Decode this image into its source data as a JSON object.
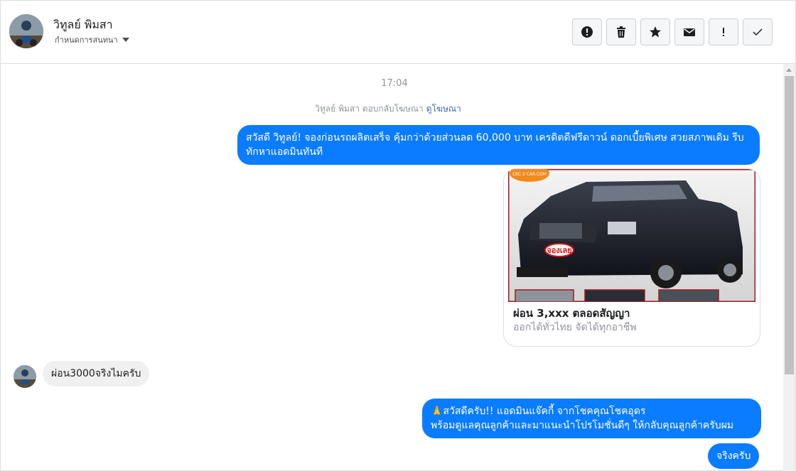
{
  "header": {
    "name": "วิทูลย์ พิมสา",
    "subtitle": "กำหนดการสนทนา",
    "actions": [
      {
        "icon": "alert-circle-icon"
      },
      {
        "icon": "trash-icon"
      },
      {
        "icon": "star-icon"
      },
      {
        "icon": "envelope-icon"
      },
      {
        "icon": "exclamation-icon"
      },
      {
        "icon": "checkmark-icon"
      }
    ]
  },
  "conversation": {
    "timestamp": "17:04",
    "reply_note": "วิทูลย์ พิมสา ตอบกลับโฆษณา",
    "reply_link": "ดูโฆษณา",
    "messages": [
      {
        "direction": "out",
        "text": "สวัสดี วิทูลย์! จองก่อนรถผลิตเสร็จ คุ้มกว่าด้วยส่วนลด 60,000 บาท เครดิตดีฟรีดาวน์ ดอกเบี้ยพิเศษ สวยสภาพเดิม รีบทักหาแอดมินทันที"
      },
      {
        "direction": "in",
        "text": "ผ่อน3000จริงไมครับ"
      },
      {
        "direction": "out",
        "text": "🙏สวัสดีครับ!! แอดมินแจ๊คกี้ จากโชคคุณโชคอุดร\nพร้อมดูแลคุณลูกค้าและมาแนะนำโปรโมชั่นดีๆ ให้กลับคุณลูกค้าครับผม"
      },
      {
        "direction": "out",
        "text": "จริงครับ"
      }
    ],
    "ad_card": {
      "image_logo_text": "CKC 2 CAR.COM",
      "image_sticker_text": "จองเลย",
      "title": "ผ่อน 3,xxx ตลอดสัญญา",
      "subtitle": "ออกได้ทั่วไทย จัดได้ทุกอาชีพ"
    }
  },
  "colors": {
    "outgoing_bubble": "#0a7cff",
    "incoming_bubble": "#f1f0f0",
    "link": "#4267b2"
  }
}
